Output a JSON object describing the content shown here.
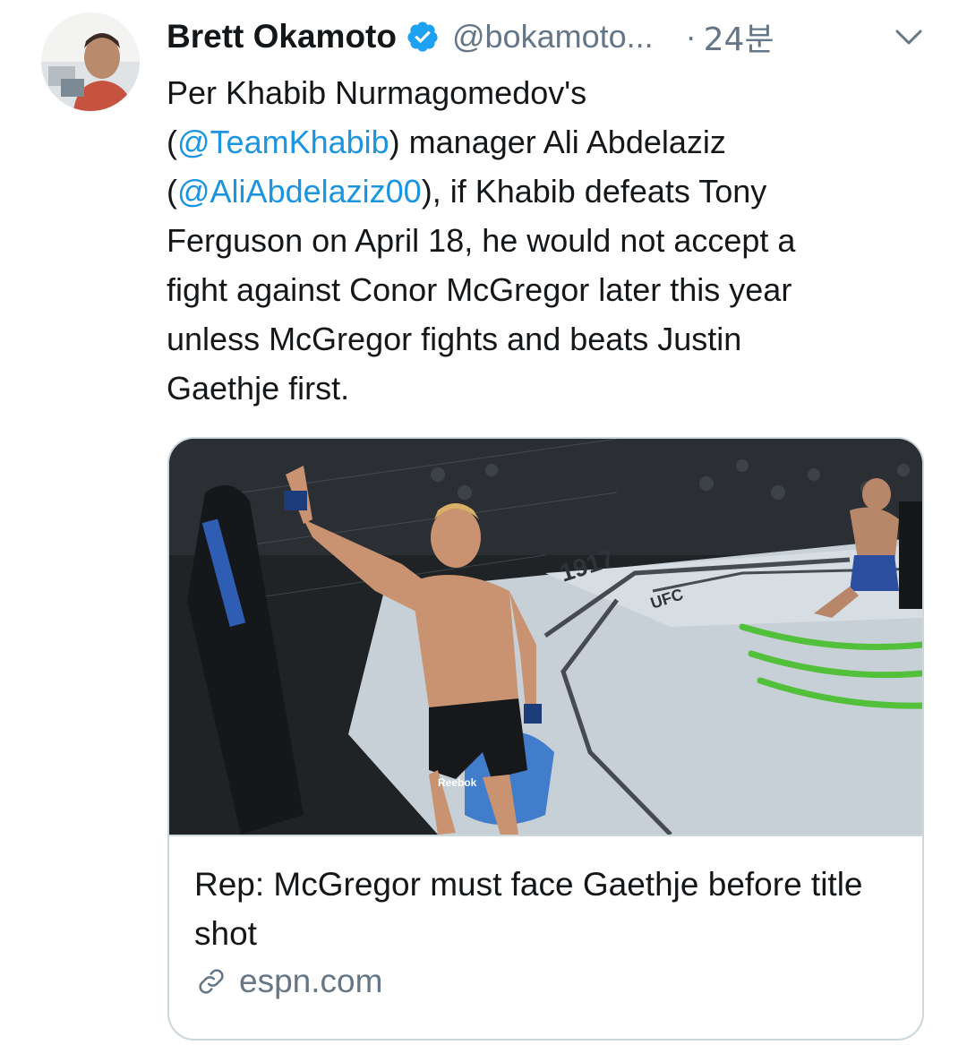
{
  "tweet": {
    "author": {
      "display_name": "Brett Okamoto",
      "handle": "@bokamoto...",
      "verified": true
    },
    "separator": "·",
    "timestamp": "24분",
    "text_lines": [
      [
        {
          "t": "Per Khabib Nurmagomedov's"
        }
      ],
      [
        {
          "t": "("
        },
        {
          "t": "@TeamKhabib",
          "mention": true
        },
        {
          "t": ") manager Ali Abdelaziz"
        }
      ],
      [
        {
          "t": "("
        },
        {
          "t": "@AliAbdelaziz00",
          "mention": true
        },
        {
          "t": "), if Khabib defeats Tony"
        }
      ],
      [
        {
          "t": "Ferguson on April 18, he would not accept a"
        }
      ],
      [
        {
          "t": "fight against Conor McGregor later this year"
        }
      ],
      [
        {
          "t": "unless McGregor fights and beats Justin"
        }
      ],
      [
        {
          "t": "Gaethje first."
        }
      ]
    ]
  },
  "card": {
    "title": "Rep: McGregor must face Gaethje before title shot",
    "domain": "espn.com",
    "image": {
      "ring_text": "1917",
      "banner_text": "UFC",
      "short_logo": "Reebok"
    }
  },
  "icons": {
    "verified": "verified-badge-icon",
    "menu": "chevron-down-icon",
    "link": "link-icon"
  },
  "colors": {
    "accent": "#1b95e0",
    "verified": "#1da1f2",
    "secondary_text": "#657786",
    "border": "#ccd6dd"
  }
}
